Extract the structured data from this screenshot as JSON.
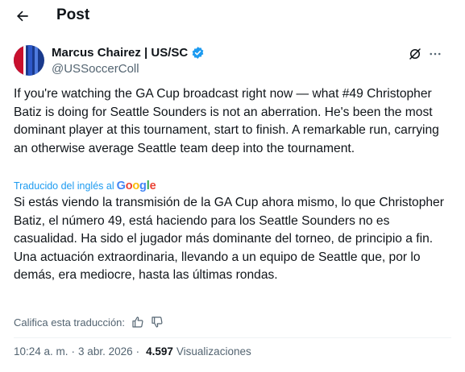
{
  "header": {
    "title": "Post"
  },
  "author": {
    "name": "Marcus Chairez | US/SC",
    "handle": "@USSoccerColl"
  },
  "tweet": {
    "text": "If you're watching the GA Cup broadcast right now — what #49 Christopher Batiz is doing for Seattle Sounders is not an aberration. He's been the most dominant player at this tournament, start to finish. A remarkable run, carrying an otherwise average Seattle team deep into the tournament."
  },
  "translation": {
    "label": "Traducido del inglés al",
    "provider": "Google",
    "text": "Si estás viendo la transmisión de la GA Cup ahora mismo, lo que Christopher Batiz, el número 49, está haciendo para los Seattle Sounders no es casualidad. Ha sido el jugador más dominante del torneo, de principio a fin. Una actuación extraordinaria, llevando a un equipo de Seattle que, por lo demás, era mediocre, hasta las últimas rondas.",
    "rate_label": "Califica esta traducción:"
  },
  "meta": {
    "time": "10:24 a. m.",
    "separator": "·",
    "date": "3 abr. 2026",
    "views_count": "4.597",
    "views_label": "Visualizaciones"
  },
  "colors": {
    "accent": "#1d9bf0",
    "text": "#0f1419",
    "secondary": "#536471"
  },
  "icons": [
    "back-arrow-icon",
    "verified-badge-icon",
    "grok-icon",
    "more-icon",
    "thumbs-up-icon",
    "thumbs-down-icon"
  ]
}
